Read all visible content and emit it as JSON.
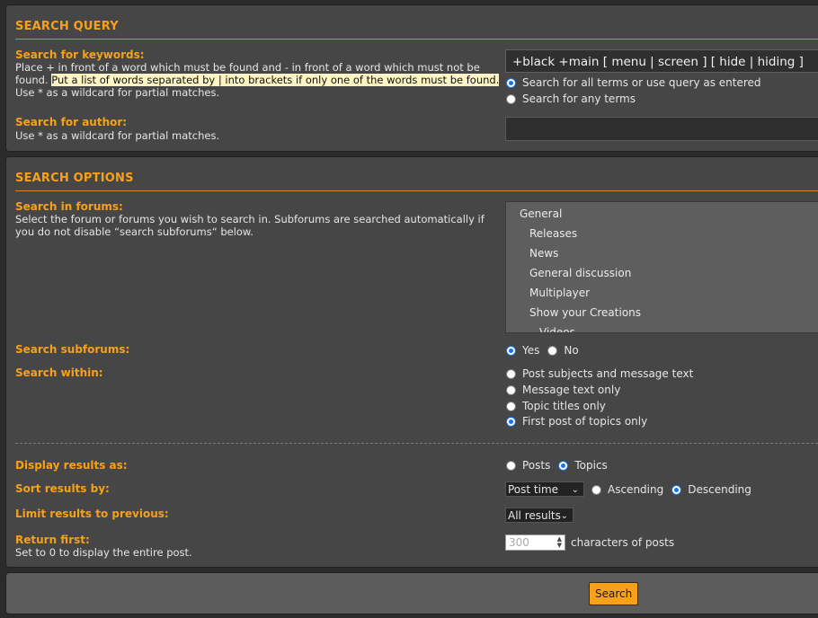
{
  "query": {
    "title": "SEARCH QUERY",
    "keywords_label": "Search for keywords:",
    "keywords_desc_1": "Place + in front of a word which must be found and - in front of a word which must not be found.",
    "keywords_desc_hl": "Put a list of words separated by | into brackets if only one of the words must be found.",
    "keywords_desc_2": " Use * as a wildcard for partial matches.",
    "keywords_value": "+black +main [ menu | screen ] [ hide | hiding ]",
    "terms_all": "Search for all terms or use query as entered",
    "terms_any": "Search for any terms",
    "terms_selected": "all",
    "author_label": "Search for author:",
    "author_desc": "Use * as a wildcard for partial matches.",
    "author_value": ""
  },
  "options": {
    "title": "SEARCH OPTIONS",
    "forums_label": "Search in forums:",
    "forums_desc": "Select the forum or forums you wish to search in. Subforums are searched automatically if you do not disable “search subforums“ below.",
    "forums": [
      "General",
      "Releases",
      "News",
      "General discussion",
      "Multiplayer",
      "Show your Creations",
      "Videos"
    ],
    "subforums_label": "Search subforums:",
    "subforums_yes": "Yes",
    "subforums_no": "No",
    "within_label": "Search within:",
    "within_options": [
      "Post subjects and message text",
      "Message text only",
      "Topic titles only",
      "First post of topics only"
    ],
    "display_label": "Display results as:",
    "display_posts": "Posts",
    "display_topics": "Topics",
    "sort_label": "Sort results by:",
    "sort_value": "Post time",
    "sort_asc": "Ascending",
    "sort_desc": "Descending",
    "limit_label": "Limit results to previous:",
    "limit_value": "All results",
    "return_label": "Return first:",
    "return_desc": "Set to 0 to display the entire post.",
    "return_value": "300",
    "return_suffix": "characters of posts"
  },
  "footer": {
    "search_button": "Search"
  },
  "colors": {
    "accent": "#f7a11a",
    "panel_bg": "#464646",
    "radio_selected": "#1a73e8"
  }
}
